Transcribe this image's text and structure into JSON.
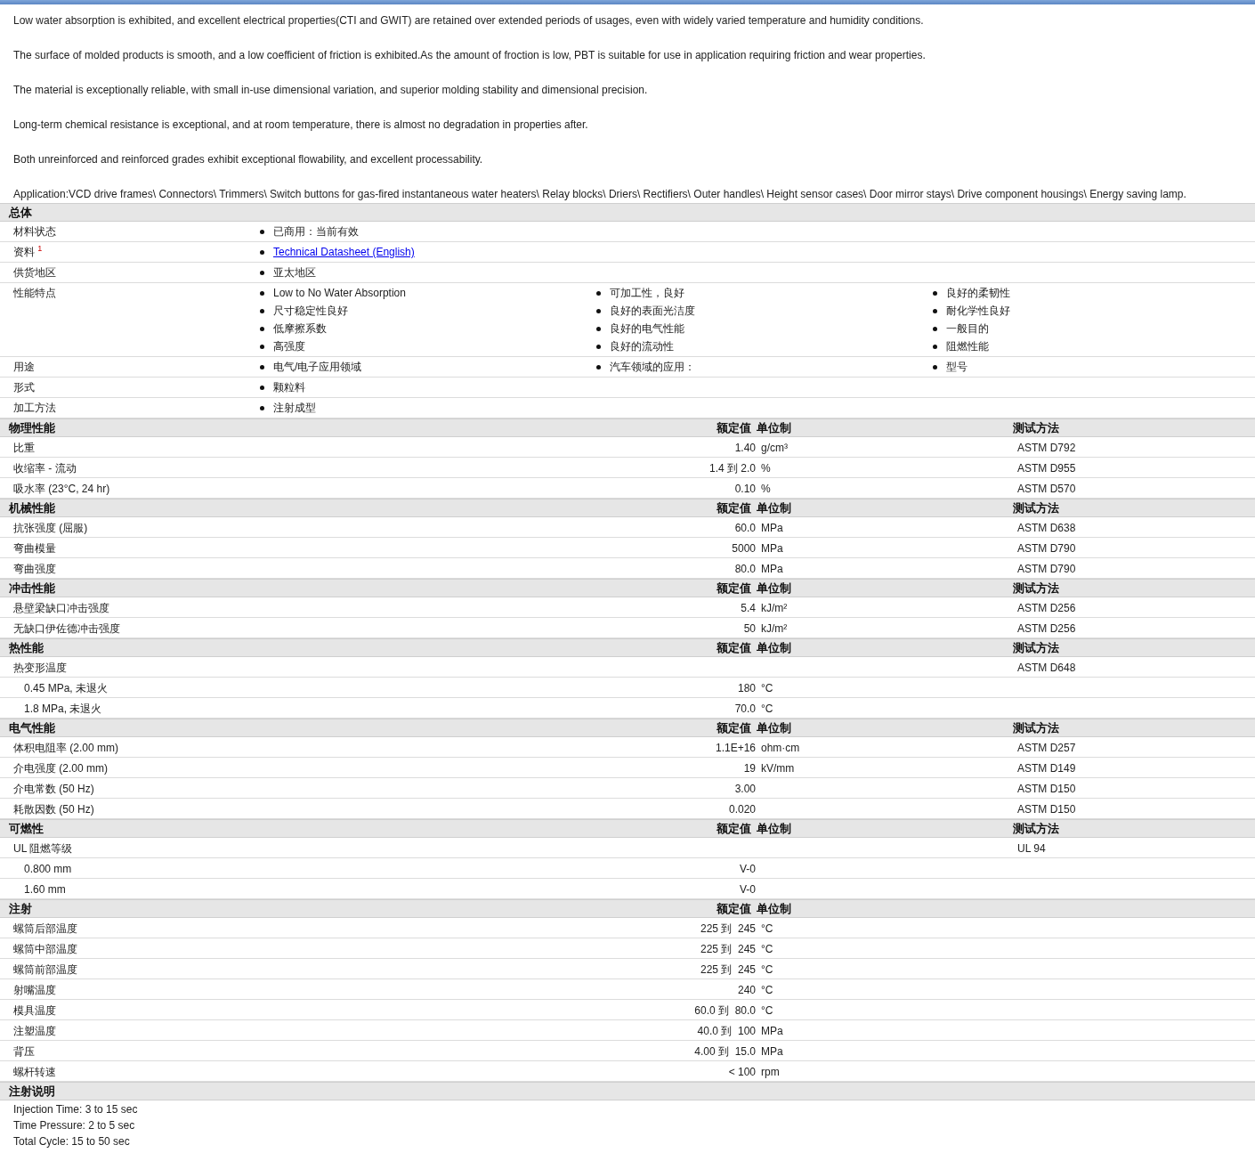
{
  "paragraphs": [
    "Low water absorption is exhibited, and excellent electrical properties(CTI and GWIT) are retained over extended periods of usages, even with widely varied temperature and humidity conditions.",
    "The surface of molded products is smooth, and a low coefficient of friction is exhibited.As the amount of froction is low, PBT is suitable for use in application requiring friction and wear properties.",
    "The material is exceptionally reliable, with small in-use dimensional variation, and superior molding stability and dimensional precision.",
    "Long-term chemical resistance is exceptional, and at room temperature, there is almost no degradation in properties after.",
    "Both unreinforced and reinforced grades exhibit exceptional flowability, and excellent processability.",
    "Application:VCD drive frames\\ Connectors\\ Trimmers\\ Switch buttons for gas-fired instantaneous water heaters\\ Relay blocks\\ Driers\\ Rectifiers\\ Outer handles\\ Height sensor cases\\ Door mirror stays\\ Drive component housings\\ Energy saving lamp."
  ],
  "general": {
    "title": "总体",
    "rows": [
      {
        "label": "材料状态",
        "columns": [
          [
            {
              "kind": "text",
              "text": "已商用：当前有效"
            }
          ]
        ]
      },
      {
        "label": "资料 $^{1}$",
        "columns": [
          [
            {
              "kind": "link",
              "text": "Technical Datasheet (English)"
            }
          ]
        ]
      },
      {
        "label": "供货地区",
        "columns": [
          [
            {
              "kind": "text",
              "text": "亚太地区"
            }
          ]
        ]
      },
      {
        "label": "性能特点",
        "columns": [
          [
            {
              "kind": "text",
              "text": "Low to No Water Absorption"
            },
            {
              "kind": "text",
              "text": "尺寸稳定性良好"
            },
            {
              "kind": "text",
              "text": "低摩擦系数"
            },
            {
              "kind": "text",
              "text": "高强度"
            }
          ],
          [
            {
              "kind": "text",
              "text": "可加工性，良好"
            },
            {
              "kind": "text",
              "text": "良好的表面光洁度"
            },
            {
              "kind": "text",
              "text": "良好的电气性能"
            },
            {
              "kind": "text",
              "text": "良好的流动性"
            }
          ],
          [
            {
              "kind": "text",
              "text": "良好的柔韧性"
            },
            {
              "kind": "text",
              "text": "耐化学性良好"
            },
            {
              "kind": "text",
              "text": "一般目的"
            },
            {
              "kind": "text",
              "text": "阻燃性能"
            }
          ]
        ]
      },
      {
        "label": "用途",
        "columns": [
          [
            {
              "kind": "text",
              "text": "电气/电子应用领域"
            }
          ],
          [
            {
              "kind": "text",
              "text": "汽车领域的应用："
            }
          ],
          [
            {
              "kind": "text",
              "text": "型号"
            }
          ]
        ]
      },
      {
        "label": "形式",
        "columns": [
          [
            {
              "kind": "text",
              "text": "颗粒料"
            }
          ]
        ]
      },
      {
        "label": "加工方法",
        "columns": [
          [
            {
              "kind": "text",
              "text": "注射成型"
            }
          ]
        ]
      }
    ]
  },
  "sections": [
    {
      "title": "物理性能",
      "value_header": "额定值",
      "unit_header": "单位制",
      "method_header": "测试方法",
      "rows": [
        {
          "name": "比重",
          "value": "1.40",
          "unit": "g/cm³",
          "method": "ASTM D792"
        },
        {
          "name": "收缩率 - 流动",
          "value": "1.4 到 2.0",
          "unit": "%",
          "method": "ASTM D955"
        },
        {
          "name": "吸水率 (23°C, 24 hr)",
          "value": "0.10",
          "unit": "%",
          "method": "ASTM D570"
        }
      ]
    },
    {
      "title": "机械性能",
      "value_header": "额定值",
      "unit_header": "单位制",
      "method_header": "测试方法",
      "rows": [
        {
          "name": "抗张强度 (屈服)",
          "value": "60.0",
          "unit": "MPa",
          "method": "ASTM D638"
        },
        {
          "name": "弯曲模量",
          "value": "5000",
          "unit": "MPa",
          "method": "ASTM D790"
        },
        {
          "name": "弯曲强度",
          "value": "80.0",
          "unit": "MPa",
          "method": "ASTM D790"
        }
      ]
    },
    {
      "title": "冲击性能",
      "value_header": "额定值",
      "unit_header": "单位制",
      "method_header": "测试方法",
      "rows": [
        {
          "name": "悬壁梁缺口冲击强度",
          "value": "5.4",
          "unit": "kJ/m²",
          "method": "ASTM D256"
        },
        {
          "name": "无缺口伊佐德冲击强度",
          "value": "50",
          "unit": "kJ/m²",
          "method": "ASTM D256"
        }
      ]
    },
    {
      "title": "热性能",
      "value_header": "额定值",
      "unit_header": "单位制",
      "method_header": "测试方法",
      "rows": [
        {
          "name": "热变形温度",
          "method": "ASTM D648",
          "children": [
            {
              "name": "0.45 MPa, 未退火",
              "value": "180",
              "unit": "°C"
            },
            {
              "name": "1.8 MPa, 未退火",
              "value": "70.0",
              "unit": "°C"
            }
          ]
        }
      ]
    },
    {
      "title": "电气性能",
      "value_header": "额定值",
      "unit_header": "单位制",
      "method_header": "测试方法",
      "rows": [
        {
          "name": "体积电阻率 (2.00 mm)",
          "value": "1.1E+16",
          "unit": "ohm·cm",
          "method": "ASTM D257"
        },
        {
          "name": "介电强度 (2.00 mm)",
          "value": "19",
          "unit": "kV/mm",
          "method": "ASTM D149"
        },
        {
          "name": "介电常数 (50 Hz)",
          "value": "3.00",
          "method": "ASTM D150"
        },
        {
          "name": "耗散因数 (50 Hz)",
          "value": "0.020",
          "method": "ASTM D150"
        }
      ]
    },
    {
      "title": "可燃性",
      "value_header": "额定值",
      "unit_header": "单位制",
      "method_header": "测试方法",
      "rows": [
        {
          "name": "UL 阻燃等级",
          "method": "UL 94",
          "children": [
            {
              "name": "0.800 mm",
              "value": "V-0"
            },
            {
              "name": "1.60 mm",
              "value": "V-0"
            }
          ]
        }
      ]
    },
    {
      "title": "注射",
      "value_header": "额定值",
      "unit_header": "单位制",
      "rows": [
        {
          "name": "螺筒后部温度",
          "value": "225 到  245",
          "unit": "°C"
        },
        {
          "name": "螺筒中部温度",
          "value": "225 到  245",
          "unit": "°C"
        },
        {
          "name": "螺筒前部温度",
          "value": "225 到  245",
          "unit": "°C"
        },
        {
          "name": "射嘴温度",
          "value": "240",
          "unit": "°C"
        },
        {
          "name": "模具温度",
          "value": "60.0 到  80.0",
          "unit": "°C"
        },
        {
          "name": "注塑温度",
          "value": "40.0 到  100",
          "unit": "MPa"
        },
        {
          "name": "背压",
          "value": "4.00 到  15.0",
          "unit": "MPa"
        },
        {
          "name": "螺杆转速",
          "value": "< 100",
          "unit": "rpm"
        }
      ]
    }
  ],
  "notes": {
    "title": "注射说明",
    "lines": [
      "Injection Time: 3 to 15 sec",
      "Time Pressure: 2 to 5 sec",
      "Total Cycle: 15 to 50 sec"
    ]
  }
}
